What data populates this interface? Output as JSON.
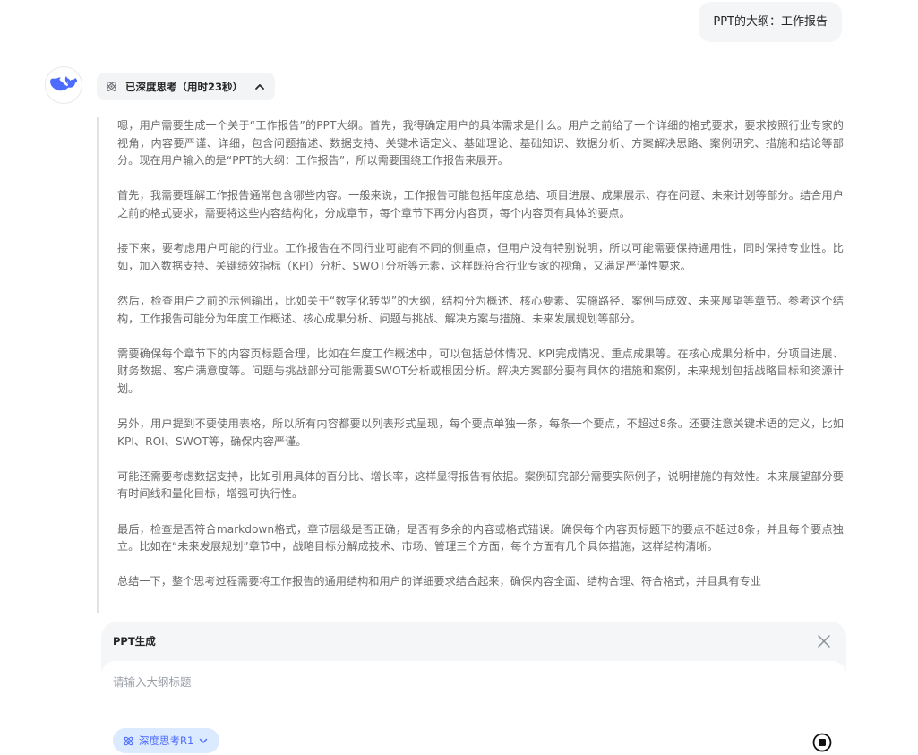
{
  "user_message": "PPT的大纲：工作报告",
  "think_toggle": {
    "label": "已深度思考（用时23秒）"
  },
  "reasoning_paragraphs": [
    "嗯，用户需要生成一个关于“工作报告”的PPT大纲。首先，我得确定用户的具体需求是什么。用户之前给了一个详细的格式要求，要求按照行业专家的视角，内容要严谨、详细，包含问题描述、数据支持、关键术语定义、基础理论、基础知识、数据分析、方案解决思路、案例研究、措施和结论等部分。现在用户输入的是“PPT的大纲：工作报告”，所以需要围绕工作报告来展开。",
    "首先，我需要理解工作报告通常包含哪些内容。一般来说，工作报告可能包括年度总结、项目进展、成果展示、存在问题、未来计划等部分。结合用户之前的格式要求，需要将这些内容结构化，分成章节，每个章节下再分内容页，每个内容页有具体的要点。",
    "接下来，要考虑用户可能的行业。工作报告在不同行业可能有不同的侧重点，但用户没有特别说明，所以可能需要保持通用性，同时保持专业性。比如，加入数据支持、关键绩效指标（KPI）分析、SWOT分析等元素，这样既符合行业专家的视角，又满足严谨性要求。",
    "然后，检查用户之前的示例输出，比如关于“数字化转型”的大纲，结构分为概述、核心要素、实施路径、案例与成效、未来展望等章节。参考这个结构，工作报告可能分为年度工作概述、核心成果分析、问题与挑战、解决方案与措施、未来发展规划等部分。",
    "需要确保每个章节下的内容页标题合理，比如在年度工作概述中，可以包括总体情况、KPI完成情况、重点成果等。在核心成果分析中，分项目进展、财务数据、客户满意度等。问题与挑战部分可能需要SWOT分析或根因分析。解决方案部分要有具体的措施和案例，未来规划包括战略目标和资源计划。",
    "另外，用户提到不要使用表格，所以所有内容都要以列表形式呈现，每个要点单独一条，每条一个要点，不超过8条。还要注意关键术语的定义，比如KPI、ROI、SWOT等，确保内容严谨。",
    "可能还需要考虑数据支持，比如引用具体的百分比、增长率，这样显得报告有依据。案例研究部分需要实际例子，说明措施的有效性。未来展望部分要有时间线和量化目标，增强可执行性。",
    "最后，检查是否符合markdown格式，章节层级是否正确，是否有多余的内容或格式错误。确保每个内容页标题下的要点不超过8条，并且每个要点独立。比如在“未来发展规划”章节中，战略目标分解成技术、市场、管理三个方面，每个方面有几个具体措施，这样结构清晰。",
    "总结一下，整个思考过程需要将工作报告的通用结构和用户的详细要求结合起来，确保内容全面、结构合理、符合格式，并且具有专业"
  ],
  "panel": {
    "title": "PPT生成",
    "input_placeholder": "请输入大纲标题",
    "input_value": "",
    "mode_label": "深度思考R1"
  },
  "colors": {
    "accent": "#4d6bfe",
    "pill_bg": "#dbeafe",
    "reasoning_text": "#6b6b6b",
    "reasoning_border": "#e2e3e6"
  },
  "icons": {
    "avatar": "deepseek-whale-icon",
    "think": "atom-icon",
    "collapse": "chevron-up-icon",
    "close": "close-icon",
    "mode_chevron": "chevron-down-icon",
    "stop": "stop-icon"
  }
}
